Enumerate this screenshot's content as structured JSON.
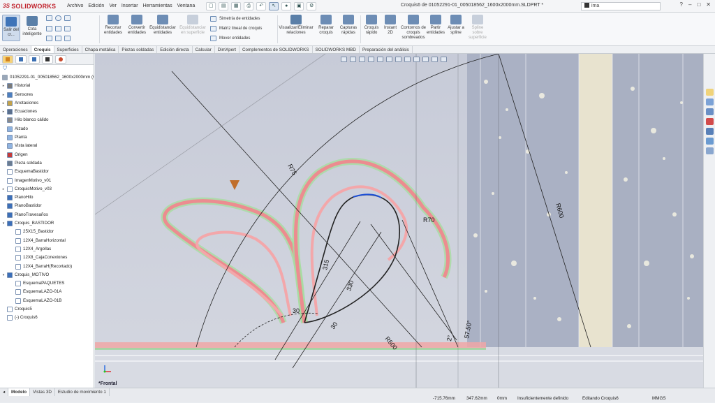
{
  "app": {
    "brand": "SOLIDWORKS",
    "brand_prefix": "3S"
  },
  "menu": [
    "Archivo",
    "Edición",
    "Ver",
    "Insertar",
    "Herramientas",
    "Ventana"
  ],
  "document_title": "Croquis6 de 01052291-01_005018562_1600x2000mm.SLDPRT *",
  "search": {
    "value": "ima"
  },
  "window_controls": [
    "?",
    "–",
    "□",
    "✕"
  ],
  "ribbon": {
    "exit_sketch": "Salir del cr...",
    "smart_dimension": "Cota inteligente",
    "trim": "Recortar entidades",
    "convert": "Convertir entidades",
    "offset": "Equidistanciar entidades",
    "offset_surface": "Equidistanciar en superficie",
    "mirror": "Simetría de entidades",
    "linear_pattern": "Matriz lineal de croquis",
    "move": "Mover entidades",
    "show_relations": "Visualizar/Eliminar relaciones",
    "repair": "Reparar croquis",
    "quick_snaps": "Capturas rápidas",
    "rapid_sketch": "Croquis rápido",
    "instant2d": "Instant 2D",
    "shaded_contours": "Contornos de croquis sombreados",
    "split": "Partir entidades",
    "fit_spline": "Ajustar a spline",
    "spline_surface": "Spline sobre superficie"
  },
  "tabs": [
    "Operaciones",
    "Croquis",
    "Superficies",
    "Chapa metálica",
    "Piezas soldadas",
    "Edición directa",
    "Calcular",
    "DimXpert",
    "Complementos de SOLIDWORKS",
    "SOLIDWORKS MBD",
    "Preparación del análisis"
  ],
  "active_tab": "Croquis",
  "tree": {
    "root": "01052291-01_005018562_1600x2000mm (Co",
    "items": [
      {
        "label": "Historial",
        "arrow": "▸",
        "color": "#7a7a7a"
      },
      {
        "label": "Sensores",
        "arrow": "▸",
        "color": "#4d7fbf"
      },
      {
        "label": "Anotaciones",
        "arrow": "▸",
        "color": "#c4a24a"
      },
      {
        "label": "Ecuaciones",
        "arrow": "▸",
        "color": "#5a6f8d"
      },
      {
        "label": "Hilo blanco cálido",
        "arrow": "",
        "color": "#8a8a8a"
      },
      {
        "label": "Alzado",
        "arrow": "",
        "color": "#8fb3e0"
      },
      {
        "label": "Planta",
        "arrow": "",
        "color": "#8fb3e0"
      },
      {
        "label": "Vista lateral",
        "arrow": "",
        "color": "#8fb3e0"
      },
      {
        "label": "Origen",
        "arrow": "",
        "color": "#c43b3b"
      },
      {
        "label": "Pieza soldada",
        "arrow": "",
        "color": "#6a7c91"
      },
      {
        "label": "EsquemaBastidor",
        "arrow": "",
        "color": "#ffffff"
      },
      {
        "label": "ImagenMotivo_v01",
        "arrow": "",
        "color": "#ffffff"
      },
      {
        "label": "CroquisMotivo_v03",
        "arrow": "▸",
        "color": "#ffffff"
      },
      {
        "label": "PlanoHilo",
        "arrow": "",
        "color": "#3c6fb8"
      },
      {
        "label": "PlanoBastidor",
        "arrow": "",
        "color": "#3c6fb8"
      },
      {
        "label": "PlanoTravesaños",
        "arrow": "",
        "color": "#3c6fb8"
      },
      {
        "label": "Croquis_BASTIDOR",
        "arrow": "▾",
        "color": "#3c6fb8"
      },
      {
        "label": "25X15_Bastidor",
        "arrow": "",
        "color": "#ffffff",
        "indent": 1
      },
      {
        "label": "12X4_BarraHorizontal",
        "arrow": "",
        "color": "#ffffff",
        "indent": 1
      },
      {
        "label": "12X4_Argollas",
        "arrow": "",
        "color": "#ffffff",
        "indent": 1
      },
      {
        "label": "12X8_CajaConexiones",
        "arrow": "",
        "color": "#ffffff",
        "indent": 1
      },
      {
        "label": "12X4_BarraH(Recortado)",
        "arrow": "",
        "color": "#ffffff",
        "indent": 1
      },
      {
        "label": "Croquis_MOTIVO",
        "arrow": "▾",
        "color": "#3c6fb8"
      },
      {
        "label": "EsquemaPAQUETES",
        "arrow": "",
        "color": "#ffffff",
        "indent": 1
      },
      {
        "label": "EsquemaLAZO-01A",
        "arrow": "",
        "color": "#ffffff",
        "indent": 1
      },
      {
        "label": "EsquemaLAZO-01B",
        "arrow": "",
        "color": "#ffffff",
        "indent": 1
      },
      {
        "label": "Croquis5",
        "arrow": "",
        "color": "#ffffff"
      },
      {
        "label": "(-) Croquis6",
        "arrow": "",
        "color": "#ffffff"
      }
    ]
  },
  "dimensions": {
    "r75": "R75",
    "r70": "R70",
    "r600a": "R600",
    "r600b": "R600",
    "d315": "315",
    "d330": "330",
    "d30a": "30",
    "d30b": "30",
    "a5750": "57.50°",
    "a2": "2°"
  },
  "view_label": "*Frontal",
  "bottom_tabs": [
    "Modelo",
    "Vistas 3D",
    "Estudio de movimiento 1"
  ],
  "status": {
    "x": "-715.76mm",
    "y": "347.62mm",
    "z": "0mm",
    "state": "Insuficientemente definido",
    "editing": "Editando Croquis6",
    "units": "MMGS"
  }
}
